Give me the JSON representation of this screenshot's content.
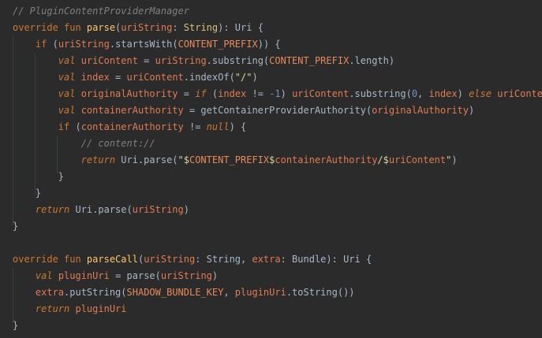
{
  "editor": {
    "lines": [
      {
        "indent": 0,
        "tokens": [
          {
            "t": "// PluginContentProviderManager",
            "c": "cm"
          }
        ]
      },
      {
        "indent": 0,
        "tokens": [
          {
            "t": "override fun ",
            "c": "kw"
          },
          {
            "t": "parse",
            "c": "fn"
          },
          {
            "t": "(",
            "c": "p"
          },
          {
            "t": "uriString",
            "c": "var"
          },
          {
            "t": ": ",
            "c": "p"
          },
          {
            "t": "String",
            "c": "type"
          },
          {
            "t": "): Uri {",
            "c": "p"
          }
        ]
      },
      {
        "indent": 1,
        "tokens": [
          {
            "t": "if ",
            "c": "kw"
          },
          {
            "t": "(",
            "c": "p"
          },
          {
            "t": "uriString",
            "c": "var"
          },
          {
            "t": ".startsWith(",
            "c": "p"
          },
          {
            "t": "CONTENT_PREFIX",
            "c": "const"
          },
          {
            "t": ")) {",
            "c": "p"
          }
        ]
      },
      {
        "indent": 2,
        "tokens": [
          {
            "t": "val ",
            "c": "it"
          },
          {
            "t": "uriContent",
            "c": "var"
          },
          {
            "t": " = ",
            "c": "p"
          },
          {
            "t": "uriString",
            "c": "var"
          },
          {
            "t": ".substring(",
            "c": "p"
          },
          {
            "t": "CONTENT_PREFIX",
            "c": "const"
          },
          {
            "t": ".length)",
            "c": "p"
          }
        ]
      },
      {
        "indent": 2,
        "tokens": [
          {
            "t": "val ",
            "c": "it"
          },
          {
            "t": "index",
            "c": "var"
          },
          {
            "t": " = ",
            "c": "p"
          },
          {
            "t": "uriContent",
            "c": "var"
          },
          {
            "t": ".indexOf(",
            "c": "p"
          },
          {
            "t": "\"/\"",
            "c": "str"
          },
          {
            "t": ")",
            "c": "p"
          }
        ]
      },
      {
        "indent": 2,
        "tokens": [
          {
            "t": "val ",
            "c": "it"
          },
          {
            "t": "originalAuthority",
            "c": "var"
          },
          {
            "t": " = ",
            "c": "p"
          },
          {
            "t": "if ",
            "c": "it"
          },
          {
            "t": "(",
            "c": "p"
          },
          {
            "t": "index",
            "c": "var"
          },
          {
            "t": " != ",
            "c": "p"
          },
          {
            "t": "-1",
            "c": "num"
          },
          {
            "t": ") ",
            "c": "p"
          },
          {
            "t": "uriContent",
            "c": "var"
          },
          {
            "t": ".substring(",
            "c": "p"
          },
          {
            "t": "0",
            "c": "num"
          },
          {
            "t": ", ",
            "c": "p"
          },
          {
            "t": "index",
            "c": "var"
          },
          {
            "t": ") ",
            "c": "p"
          },
          {
            "t": "else ",
            "c": "it"
          },
          {
            "t": "uriContent",
            "c": "var"
          }
        ]
      },
      {
        "indent": 2,
        "tokens": [
          {
            "t": "val ",
            "c": "it"
          },
          {
            "t": "containerAuthority",
            "c": "var"
          },
          {
            "t": " = getContainerProviderAuthority(",
            "c": "p"
          },
          {
            "t": "originalAuthority",
            "c": "var"
          },
          {
            "t": ")",
            "c": "p"
          }
        ]
      },
      {
        "indent": 2,
        "tokens": [
          {
            "t": "if ",
            "c": "kw"
          },
          {
            "t": "(",
            "c": "p"
          },
          {
            "t": "containerAuthority",
            "c": "var"
          },
          {
            "t": " != ",
            "c": "p"
          },
          {
            "t": "null",
            "c": "it"
          },
          {
            "t": ") {",
            "c": "p"
          }
        ]
      },
      {
        "indent": 3,
        "tokens": [
          {
            "t": "// content://",
            "c": "cm"
          }
        ]
      },
      {
        "indent": 3,
        "tokens": [
          {
            "t": "return ",
            "c": "it"
          },
          {
            "t": "Uri.parse(",
            "c": "p"
          },
          {
            "t": "\"$",
            "c": "str"
          },
          {
            "t": "CONTENT_PREFIX",
            "c": "const"
          },
          {
            "t": "$",
            "c": "str"
          },
          {
            "t": "containerAuthority",
            "c": "var"
          },
          {
            "t": "/$",
            "c": "str"
          },
          {
            "t": "uriContent",
            "c": "var"
          },
          {
            "t": "\"",
            "c": "str"
          },
          {
            "t": ")",
            "c": "p"
          }
        ]
      },
      {
        "indent": 2,
        "tokens": [
          {
            "t": "}",
            "c": "p"
          }
        ]
      },
      {
        "indent": 1,
        "tokens": [
          {
            "t": "}",
            "c": "p"
          }
        ]
      },
      {
        "indent": 1,
        "tokens": [
          {
            "t": "return ",
            "c": "it"
          },
          {
            "t": "Uri.parse(",
            "c": "p"
          },
          {
            "t": "uriString",
            "c": "var"
          },
          {
            "t": ")",
            "c": "p"
          }
        ]
      },
      {
        "indent": 0,
        "tokens": [
          {
            "t": "}",
            "c": "p"
          }
        ]
      },
      {
        "indent": 0,
        "tokens": []
      },
      {
        "indent": 0,
        "tokens": [
          {
            "t": "override fun ",
            "c": "kw"
          },
          {
            "t": "parseCall",
            "c": "fn"
          },
          {
            "t": "(",
            "c": "p"
          },
          {
            "t": "uriString",
            "c": "var"
          },
          {
            "t": ": String, ",
            "c": "p"
          },
          {
            "t": "extra",
            "c": "var"
          },
          {
            "t": ": Bundle): Uri {",
            "c": "p"
          }
        ]
      },
      {
        "indent": 1,
        "tokens": [
          {
            "t": "val ",
            "c": "it"
          },
          {
            "t": "pluginUri",
            "c": "var"
          },
          {
            "t": " = parse(",
            "c": "p"
          },
          {
            "t": "uriString",
            "c": "var"
          },
          {
            "t": ")",
            "c": "p"
          }
        ]
      },
      {
        "indent": 1,
        "tokens": [
          {
            "t": "extra",
            "c": "var"
          },
          {
            "t": ".putString(",
            "c": "p"
          },
          {
            "t": "SHADOW_BUNDLE_KEY",
            "c": "const"
          },
          {
            "t": ", ",
            "c": "p"
          },
          {
            "t": "pluginUri",
            "c": "var"
          },
          {
            "t": ".toString())",
            "c": "p"
          }
        ]
      },
      {
        "indent": 1,
        "tokens": [
          {
            "t": "return ",
            "c": "it"
          },
          {
            "t": "pluginUri",
            "c": "var"
          }
        ]
      },
      {
        "indent": 0,
        "tokens": [
          {
            "t": "}",
            "c": "p"
          }
        ]
      }
    ]
  }
}
